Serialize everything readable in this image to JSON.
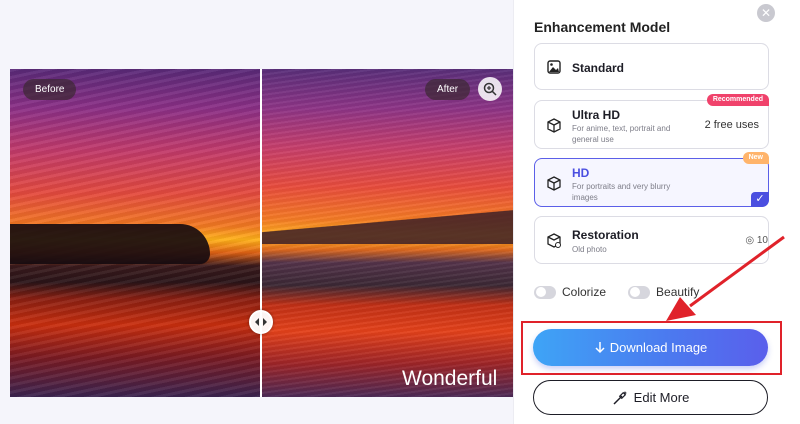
{
  "preview": {
    "before_label": "Before",
    "after_label": "After",
    "watermark": "Wonderful"
  },
  "panel": {
    "title": "Enhancement Model",
    "models": [
      {
        "name": "Standard"
      },
      {
        "name": "Ultra HD",
        "desc": "For anime, text, portrait and general use",
        "badge": "Recommended",
        "extra": "2 free uses"
      },
      {
        "name": "HD",
        "desc": "For portraits and very blurry images",
        "badge": "New",
        "selected": true
      },
      {
        "name": "Restoration",
        "desc": "Old photo",
        "extra": "10"
      }
    ],
    "toggles": {
      "colorize": "Colorize",
      "beautify": "Beautify"
    }
  },
  "actions": {
    "download": "Download Image",
    "edit_more": "Edit More"
  },
  "colors": {
    "accent": "#4b4fe0",
    "download_start": "#3ea4f6",
    "download_end": "#5a5fec",
    "highlight": "#e0222a",
    "recommended_badge": "#f0426b",
    "new_badge": "#ffb46b"
  }
}
